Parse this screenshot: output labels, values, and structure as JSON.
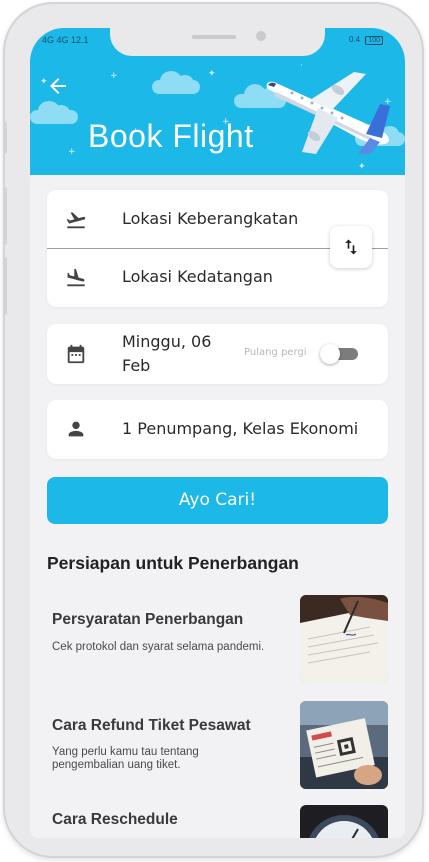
{
  "status_bar": {
    "left": "4G  4G  12.1",
    "right": "0.4",
    "battery": "100"
  },
  "header": {
    "title": "Book Flight",
    "back_icon": "arrow-left-icon",
    "illustration": "airplane-illustration",
    "background_color": "#1cb8e8"
  },
  "route": {
    "departure_placeholder": "Lokasi Keberangkatan",
    "arrival_placeholder": "Lokasi Kedatangan",
    "departure_icon": "flight-takeoff-icon",
    "arrival_icon": "flight-land-icon",
    "swap_icon": "swap-vertical-icon"
  },
  "date": {
    "value": "Minggu, 06 Feb",
    "icon": "calendar-icon",
    "return_label": "Pulang pergi",
    "return_enabled": false
  },
  "passenger": {
    "value": "1 Penumpang, Kelas Ekonomi",
    "icon": "person-icon"
  },
  "search_button": {
    "label": "Ayo Cari!",
    "color": "#1cb8e8"
  },
  "section": {
    "title": "Persiapan untuk Penerbangan"
  },
  "articles": [
    {
      "title": "Persyaratan Penerbangan",
      "desc": "Cek protokol dan syarat selama pandemi.",
      "image": "signing-document-photo"
    },
    {
      "title": "Cara Refund Tiket Pesawat",
      "desc": "Yang perlu kamu tau tentang pengembalian uang tiket.",
      "image": "boarding-pass-photo"
    },
    {
      "title": "Cara Reschedule",
      "desc": "",
      "image": "clock-photo"
    }
  ]
}
